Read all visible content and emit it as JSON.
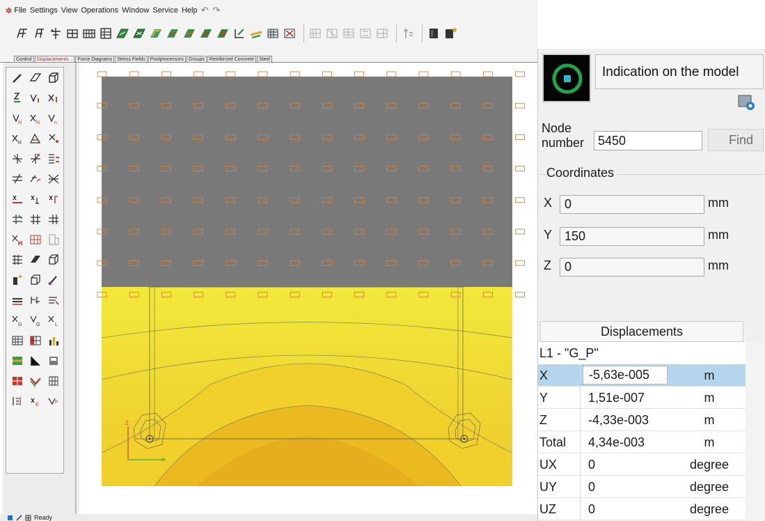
{
  "menubar": {
    "items": [
      "File",
      "Settings",
      "View",
      "Operations",
      "Window",
      "Service",
      "Help"
    ],
    "undo_icon": "undo-icon",
    "redo_icon": "redo-icon"
  },
  "tabs": [
    "Control",
    "Displacements...",
    "Force Diagrams",
    "Stress Fields",
    "Postprocessors",
    "Groups",
    "Reinforced Concrete",
    "Steel"
  ],
  "active_tab": "Displacements...",
  "statusbar": {
    "text": "Ready"
  },
  "right_panel": {
    "indication_label": "Indication on the model",
    "node_label": "Node number",
    "node_number": "5450",
    "find_label": "Find",
    "coordinates": {
      "title": "Coordinates",
      "x": {
        "label": "X",
        "value": "0",
        "unit": "mm"
      },
      "y": {
        "label": "Y",
        "value": "150",
        "unit": "mm"
      },
      "z": {
        "label": "Z",
        "value": "0",
        "unit": "mm"
      }
    },
    "displacements": {
      "title": "Displacements",
      "load_case": "L1 - \"G_P\"",
      "rows": [
        {
          "name": "X",
          "value": "-5,63e-005",
          "unit": "m"
        },
        {
          "name": "Y",
          "value": "1,51e-007",
          "unit": "m"
        },
        {
          "name": "Z",
          "value": "-4,33e-003",
          "unit": "m"
        },
        {
          "name": "Total",
          "value": "4,34e-003",
          "unit": "m"
        },
        {
          "name": "UX",
          "value": "0",
          "unit": "degree"
        },
        {
          "name": "UY",
          "value": "0",
          "unit": "degree"
        },
        {
          "name": "UZ",
          "value": "0",
          "unit": "degree"
        }
      ],
      "selected_row": "X"
    }
  },
  "model": {
    "colors": {
      "upper_region": "#7a7a7a",
      "lower_region": "#efe32e",
      "contour_dark": "#eab820",
      "contour_mid": "#f2cf2a",
      "rebar_marker": "#d9823a",
      "axis_z": "#d43c3c",
      "axis_x": "#2fae3d"
    },
    "axis_labels": {
      "z": "Z",
      "x": "X"
    }
  },
  "icons": {
    "app": "app-logo-icon",
    "indication": "node-indication-icon",
    "settings": "panel-settings-icon"
  }
}
